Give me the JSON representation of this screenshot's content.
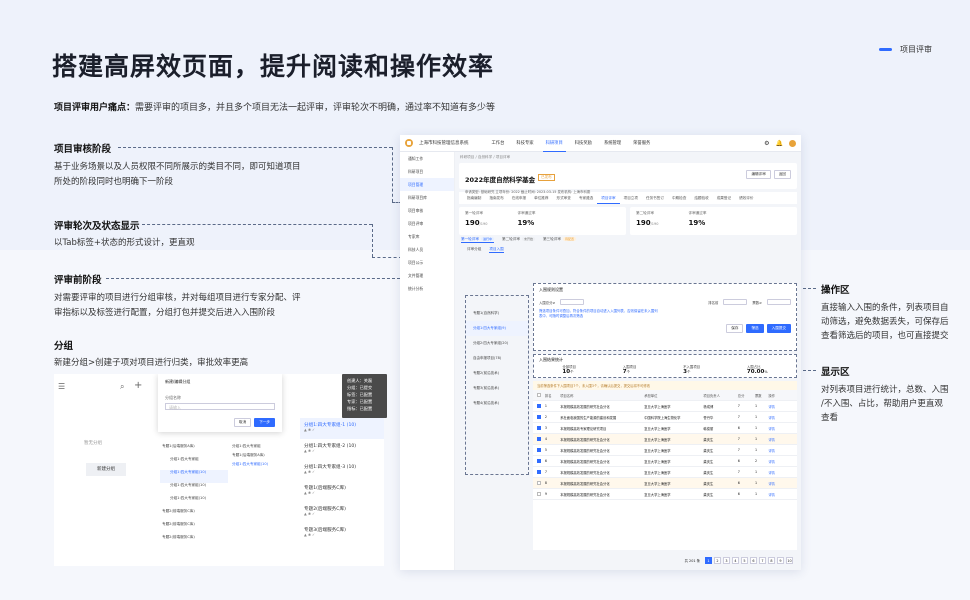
{
  "header": {
    "title": "搭建高屏效页面，提升阅读和操作效率",
    "tag": "项目评审"
  },
  "pain": {
    "label": "项目评审用户痛点：",
    "text": "需要评审的项目多，并且多个项目无法一起评审，评审轮次不明确，通过率不知道有多少等"
  },
  "sections": [
    {
      "title": "项目审核阶段",
      "lines": [
        "基于业务场景以及人员权限不同所展示的类目不同，即可知道项目",
        "所处的阶段同时也明确下一阶段"
      ]
    },
    {
      "title": "评审轮次及状态显示",
      "lines": [
        "以Tab标签+状态的形式设计，更直观"
      ]
    },
    {
      "title": "评审前阶段",
      "lines": [
        "对需要评审的项目进行分组审核，并对每组项目进行专家分配、评",
        "审指标以及标签进行配置，分组打包并提交后进入入围阶段"
      ]
    },
    {
      "title": "分组",
      "lines": [
        "新建分组>创建子项对项目进行归类，审批效率更高"
      ]
    }
  ],
  "right": [
    {
      "title": "操作区",
      "lines": [
        "直接输入入围的条件，列表项目自",
        "动筛选，避免数据丢失，可保存后",
        "查看筛选后的项目，也可直接提交"
      ]
    },
    {
      "title": "显示区",
      "lines": [
        "对列表项目进行统计，总数、入围",
        "/不入围、占比，帮助用户更直观",
        "查看"
      ]
    }
  ],
  "app": {
    "system": "上海市科技管理信息系统",
    "nav": [
      "工作台",
      "科技专家",
      "科研项目",
      "科技奖励",
      "系统管理",
      "荣誉服务"
    ],
    "nav_active": 2,
    "side": [
      "通知工作",
      "科研项目",
      "项目管理",
      "科研项目库",
      "项目审核",
      "项目评审",
      "专家库",
      "科技人员",
      "项目公示",
      "文件管理",
      "统计分析"
    ],
    "side_active": 2,
    "crumb": "科研项目 / 自然科学 / 项目评审",
    "project": {
      "name": "2022年度自然科学基金",
      "status": "已发布",
      "meta": "申请类型: 基础研究    立项年份: 2022    截止时间: 2023-03-15    发布机构: 上海市科委",
      "btn1": "编辑评审",
      "btn2": "返回"
    },
    "stages": [
      "指南编制",
      "指南发布",
      "在线申报",
      "单位推荐",
      "形式审查",
      "专家遴选",
      "项目评审",
      "项目立项",
      "任务书签订",
      "中期检查",
      "结题验收",
      "成果登记",
      "绩效评价"
    ],
    "stage_active": 6,
    "stats1": [
      {
        "label": "第一轮评审",
        "value": "190",
        "unit": "/190"
      },
      {
        "label": "评审通过率",
        "value": "19%",
        "unit": ""
      }
    ],
    "stats2": [
      {
        "label": "第二轮评审",
        "value": "190",
        "unit": "/190"
      },
      {
        "label": "评审通过率",
        "value": "19%",
        "unit": ""
      }
    ],
    "rounds": [
      {
        "label": "第一轮评审",
        "badge": "进行中"
      },
      {
        "label": "第二轮评审",
        "badge": "未开始"
      },
      {
        "label": "第三轮评审",
        "badge": "待配置"
      }
    ],
    "subtabs": [
      "评审分组",
      "项目入围"
    ],
    "groups": [
      "专题1(自然科学)",
      "分组1:四大专家组(9)",
      "分组2:四大专家组(20)",
      "自由申报项目(78)",
      "专题2(前沿技术)",
      "专题3(前沿技术)",
      "专题4(前沿技术)"
    ],
    "op": {
      "title": "入围规则设置",
      "hint": "筛选项目条件可叠加，符合条件的项目自动进入入围列表，否则保留在未入围列表中，可随时调整后再次筛选",
      "f1": "入围总分≥",
      "f2": "排名前",
      "f3": "票数≥",
      "f4": "专家意见",
      "btn_save": "保存",
      "btn_filter": "筛选",
      "btn_submit": "入围提交"
    },
    "display": {
      "title": "入围结果统计",
      "items": [
        {
          "label": "全部项目",
          "value": "10",
          "unit": "个"
        },
        {
          "label": "入围项目",
          "value": "7",
          "unit": "个"
        },
        {
          "label": "不入围项目",
          "value": "3",
          "unit": "个"
        },
        {
          "label": "入围占比",
          "value": "70.00",
          "unit": "%"
        }
      ],
      "export": "导出"
    },
    "notice": "当前筛选条件下入围项目7个，未入围3个，请确认后提交，提交后将不可修改",
    "table": {
      "headers": [
        "排名",
        "项目名称",
        "承担单位",
        "项目负责人",
        "总分",
        "票数",
        "操作"
      ],
      "rows": [
        {
          "rank": "1",
          "name": "本报规模高效发展的研究社会分化",
          "org": "复旦大学上海医学",
          "lead": "杨成博",
          "score": "7",
          "votes": "1",
          "on": true,
          "hl": false
        },
        {
          "rank": "2",
          "name": "系杜面临我国的生产能源的建设和发展",
          "org": "中国科学院上海生物化学",
          "lead": "曹丹华",
          "score": "7",
          "votes": "1",
          "on": true,
          "hl": false
        },
        {
          "rank": "3",
          "name": "本报规模高效专家理论研究项目",
          "org": "复旦大学上海医学",
          "lead": "韩俊丽",
          "score": "6",
          "votes": "1",
          "on": true,
          "hl": false
        },
        {
          "rank": "4",
          "name": "本报规模高效发展的研究社会分化",
          "org": "复旦大学上海医学",
          "lead": "龚庆生",
          "score": "7",
          "votes": "1",
          "on": true,
          "hl": true
        },
        {
          "rank": "5",
          "name": "本报规模高效发展的研究社会分化",
          "org": "复旦大学上海医学",
          "lead": "龚庆生",
          "score": "7",
          "votes": "1",
          "on": true,
          "hl": false
        },
        {
          "rank": "6",
          "name": "本报规模高效发展的研究社会分化",
          "org": "复旦大学上海医学",
          "lead": "龚庆生",
          "score": "6",
          "votes": "2",
          "on": true,
          "hl": false
        },
        {
          "rank": "7",
          "name": "本报规模高效发展的研究社会分化",
          "org": "复旦大学上海医学",
          "lead": "龚庆生",
          "score": "7",
          "votes": "1",
          "on": true,
          "hl": false
        },
        {
          "rank": "8",
          "name": "本报规模高效发展的研究社会分化",
          "org": "复旦大学上海医学",
          "lead": "龚庆生",
          "score": "6",
          "votes": "1",
          "on": false,
          "hl": true
        },
        {
          "rank": "9",
          "name": "本报规模高效发展的研究社会分化",
          "org": "复旦大学上海医学",
          "lead": "龚庆生",
          "score": "6",
          "votes": "1",
          "on": false,
          "hl": false
        }
      ],
      "action": "详情"
    },
    "pager": {
      "total": "共 201 条",
      "pages": [
        "1",
        "2",
        "3",
        "4",
        "5",
        "6",
        "7",
        "8",
        "9",
        "10"
      ],
      "active": 0
    }
  },
  "mock": {
    "new_group": "新建分组",
    "dialog_title": "新建/编辑分组",
    "field_label": "分组名称",
    "field_ph": "请输入",
    "cancel": "取消",
    "next": "下一步",
    "col_a": [
      "专题1(后端服务A库)",
      "分组1:四大专家组",
      "分组1:四大专家组(10)",
      "分组1:四大专家组(10)",
      "分组1:四大专家组(10)",
      "专题2(前端服务C库)",
      "专题2(前端服务C库)",
      "专题2(前端服务C库)"
    ],
    "col_b_title": "分组1:四大专家组",
    "col_b": [
      "专题1(后端服务A库)",
      "分组1:四大专家组(10)"
    ],
    "cards": [
      "分组1:四大专家组-1 (10)",
      "分组1:四大专家组-2 (10)",
      "分组1:四大专家组-3 (10)",
      "专题1(后端服务C库)",
      "专题2(后端服务C库)",
      "专题3(后端服务C库)"
    ],
    "tooltip": [
      "创建人：关磊",
      "分组：已提交",
      "标签：已配置",
      "专家：已配置",
      "指标：已配置"
    ],
    "empty": "暂无分组"
  }
}
